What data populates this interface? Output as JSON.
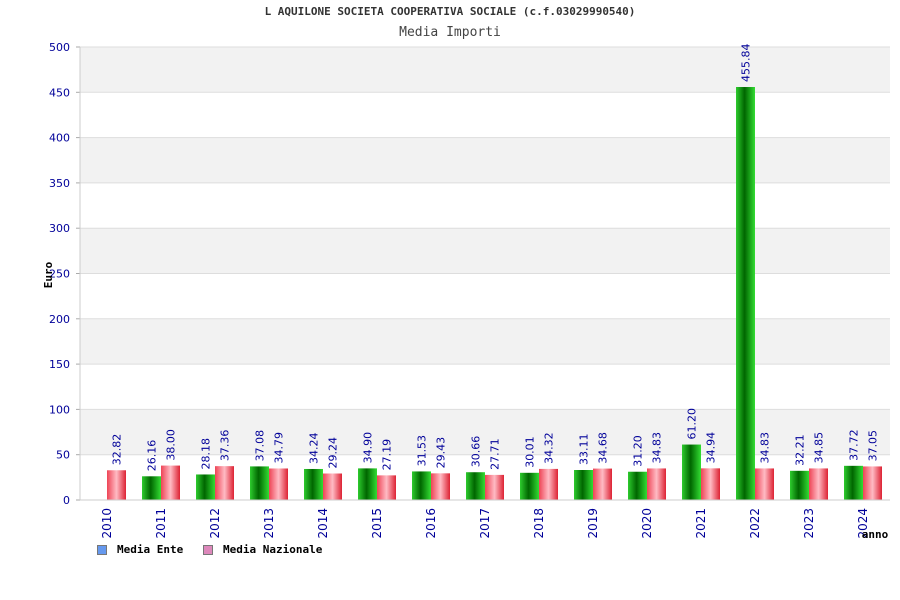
{
  "chart_data": {
    "type": "bar",
    "title": "L AQUILONE SOCIETA COOPERATIVA SOCIALE (c.f.03029990540)",
    "subtitle": "Media Importi",
    "ylabel": "Euro",
    "xlabel": "anno",
    "ylim": [
      0,
      500
    ],
    "yticks": [
      "0",
      "50",
      "100",
      "150",
      "200",
      "250",
      "300",
      "350",
      "400",
      "450",
      "500"
    ],
    "categories": [
      "2010",
      "2011",
      "2012",
      "2013",
      "2014",
      "2015",
      "2016",
      "2017",
      "2018",
      "2019",
      "2020",
      "2021",
      "2022",
      "2023",
      "2024"
    ],
    "series": [
      {
        "name": "Media Ente",
        "color": "#00bb00",
        "legend_color": "#6699ee",
        "values": [
          null,
          26.16,
          28.18,
          37.08,
          34.24,
          34.9,
          31.53,
          30.66,
          30.01,
          33.11,
          31.2,
          61.2,
          455.84,
          32.21,
          37.72
        ],
        "labels": [
          "",
          "26.16",
          "28.18",
          "37.08",
          "34.24",
          "34.90",
          "31.53",
          "30.66",
          "30.01",
          "33.11",
          "31.20",
          "61.20",
          "455.84",
          "32.21",
          "37.72"
        ]
      },
      {
        "name": "Media Nazionale",
        "color": "#ee3344",
        "legend_color": "#dd88bb",
        "values": [
          32.82,
          38.0,
          37.36,
          34.79,
          29.24,
          27.19,
          29.43,
          27.71,
          34.32,
          34.68,
          34.83,
          34.94,
          34.83,
          34.85,
          37.05
        ],
        "labels": [
          "32.82",
          "38.00",
          "37.36",
          "34.79",
          "29.24",
          "27.19",
          "29.43",
          "27.71",
          "34.32",
          "34.68",
          "34.83",
          "34.94",
          "34.83",
          "34.85",
          "37.05"
        ]
      }
    ],
    "grid": true,
    "legend_position": "bottom-left"
  }
}
